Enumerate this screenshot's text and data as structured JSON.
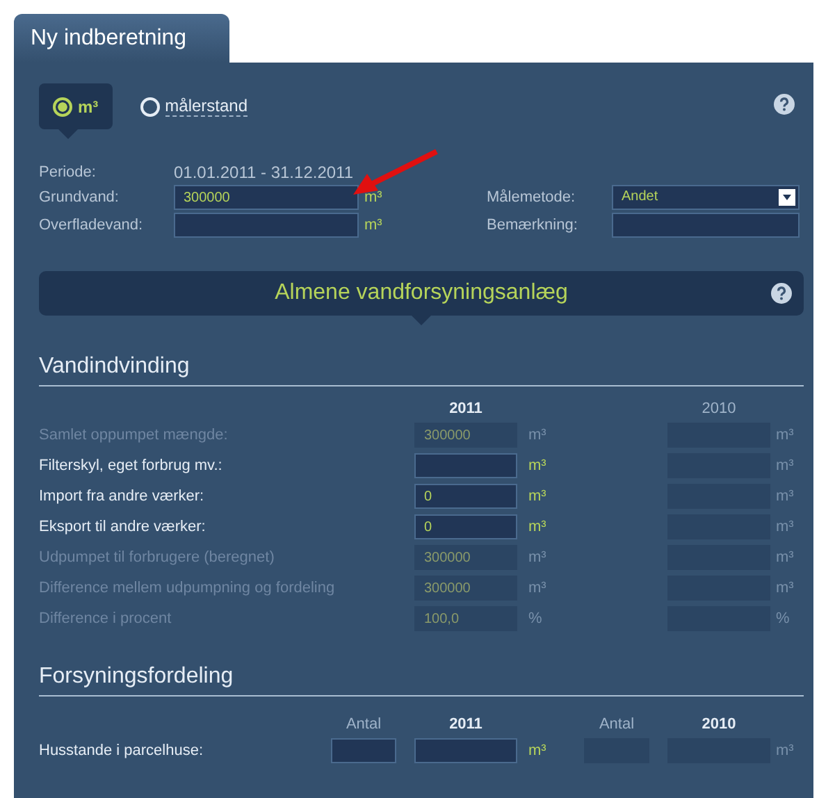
{
  "tab": {
    "label": "Ny indberetning"
  },
  "unit_mode": {
    "options": [
      {
        "label": "m³",
        "selected": true
      },
      {
        "label": "målerstand",
        "selected": false
      }
    ]
  },
  "period": {
    "label": "Periode:",
    "value": "01.01.2011 - 31.12.2011"
  },
  "fields": [
    {
      "label": "Grundvand:",
      "value": "300000",
      "unit": "m³"
    },
    {
      "label": "Overfladevand:",
      "unit": "m³"
    }
  ],
  "side_fields": [
    {
      "label": "Målemetode:",
      "kind": "select",
      "value": "Andet"
    },
    {
      "label": "Bemærkning:",
      "kind": "text"
    }
  ],
  "section_title": "Almene vandforsyningsanlæg",
  "vandindvinding": {
    "title": "Vandindvinding",
    "year_current": "2011",
    "year_previous": "2010",
    "rows": [
      {
        "label": "Samlet oppumpet mængde:",
        "disabled": true,
        "value": "300000",
        "unit_current": "m³",
        "unit_previous": "m³"
      },
      {
        "label": "Filterskyl, eget forbrug mv.:",
        "disabled": false,
        "unit_current": "m³",
        "unit_previous": "m³"
      },
      {
        "label": "Import fra andre værker:",
        "disabled": false,
        "value": "0",
        "unit_current": "m³",
        "unit_previous": "m³"
      },
      {
        "label": "Eksport til andre værker:",
        "disabled": false,
        "value": "0",
        "unit_current": "m³",
        "unit_previous": "m³"
      },
      {
        "label": "Udpumpet til forbrugere (beregnet)",
        "disabled": true,
        "value": "300000",
        "unit_current": "m³",
        "unit_previous": "m³"
      },
      {
        "label": "Difference mellem udpumpning og fordeling",
        "disabled": true,
        "value": "300000",
        "unit_current": "m³",
        "unit_previous": "m³"
      },
      {
        "label": "Difference i procent",
        "disabled": true,
        "value": "100,0",
        "unit_current": "%",
        "unit_previous": "%"
      }
    ]
  },
  "forsyningsfordeling": {
    "title": "Forsyningsfordeling",
    "columns": [
      "Antal",
      "2011",
      "Antal",
      "2010"
    ],
    "rows": [
      {
        "label": "Husstande i parcelhuse:",
        "unit_current": "m³",
        "unit_previous": "m³"
      }
    ]
  }
}
